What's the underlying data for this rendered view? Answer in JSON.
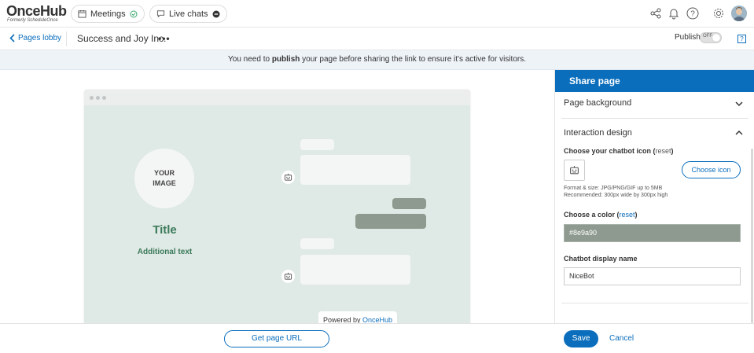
{
  "topbar": {
    "logo_main": "OnceHub",
    "logo_sub": "Formerly ScheduleOnce",
    "meetings_label": "Meetings",
    "live_chats_label": "Live chats"
  },
  "subbar": {
    "back_label": "Pages lobby",
    "page_name": "Success and Joy Inc.",
    "more_label": "•••",
    "publish_label": "Publish",
    "toggle_state": "OFF",
    "help_label": "?"
  },
  "banner": {
    "text_before": "You need to ",
    "text_bold": "publish",
    "text_after": " your page before sharing the link to ensure it's active for visitors."
  },
  "preview": {
    "image_placeholder_line1": "YOUR",
    "image_placeholder_line2": "IMAGE",
    "title": "Title",
    "additional_text": "Additional text",
    "powered_prefix": "Powered by ",
    "powered_brand": "OnceHub"
  },
  "bottom": {
    "get_url_label": "Get page URL",
    "save_label": "Save",
    "cancel_label": "Cancel"
  },
  "panel": {
    "header": "Share page",
    "section_background": "Page background",
    "section_interaction": "Interaction design",
    "chatbot_icon_label": "Choose your chatbot icon",
    "reset_label": "reset",
    "choose_icon_label": "Choose icon",
    "hint_line1": "Format & size: JPG/PNG/GIF up to 5MB",
    "hint_line2": "Recommended: 300px wide by 300px high",
    "color_label": "Choose a color",
    "color_value": "#8e9a90",
    "display_name_label": "Chatbot display name",
    "display_name_value": "NiceBot"
  },
  "colors": {
    "accent": "#0b6ebc",
    "chat_color": "#8e9a90",
    "preview_bg": "#dfe9e5",
    "title_green": "#3b7a5a"
  }
}
